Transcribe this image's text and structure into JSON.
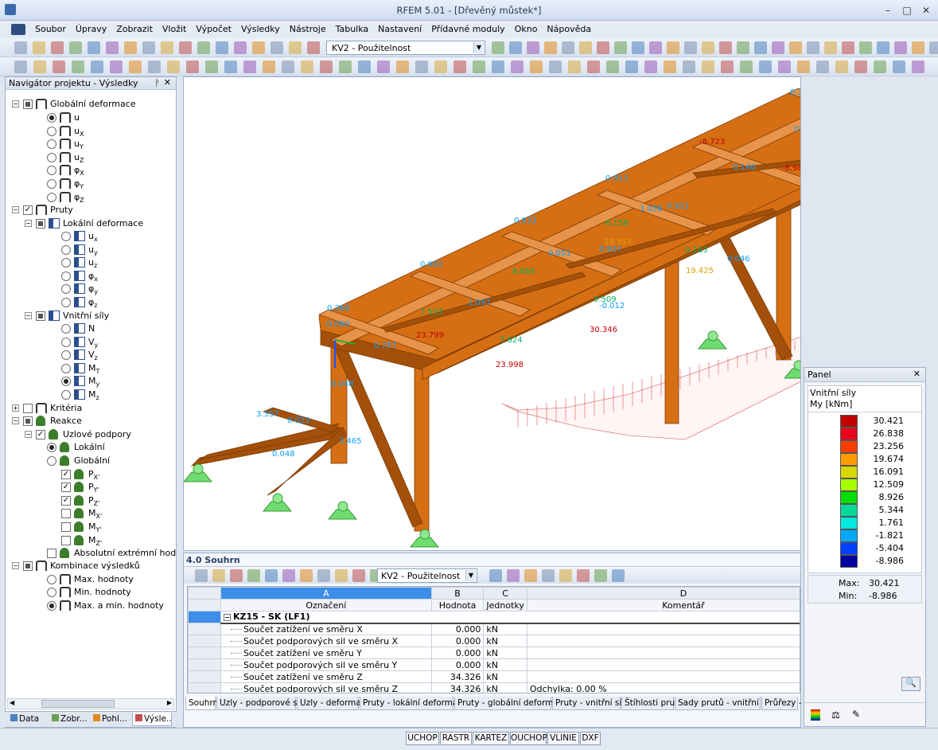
{
  "window": {
    "title": "RFEM 5.01 - [Dřevěný můstek*]"
  },
  "menu": [
    "Soubor",
    "Úpravy",
    "Zobrazit",
    "Vložit",
    "Výpočet",
    "Výsledky",
    "Nástroje",
    "Tabulka",
    "Nastavení",
    "Přídavné moduly",
    "Okno",
    "Nápověda"
  ],
  "toolbar": {
    "loadcase": "KV2 - Použitelnost"
  },
  "navigator": {
    "title": "Navigátor projektu - Výsledky",
    "items": [
      {
        "label": "Globální deformace",
        "sub": ""
      },
      {
        "label": "u",
        "sub": ""
      },
      {
        "label": "u",
        "sub": "X"
      },
      {
        "label": "u",
        "sub": "Y"
      },
      {
        "label": "u",
        "sub": "Z"
      },
      {
        "label": "φ",
        "sub": "X"
      },
      {
        "label": "φ",
        "sub": "Y"
      },
      {
        "label": "φ",
        "sub": "Z"
      },
      {
        "label": "Pruty",
        "sub": ""
      },
      {
        "label": "Lokální deformace",
        "sub": ""
      },
      {
        "label": "u",
        "sub": "x"
      },
      {
        "label": "u",
        "sub": "y"
      },
      {
        "label": "u",
        "sub": "z"
      },
      {
        "label": "φ",
        "sub": "x"
      },
      {
        "label": "φ",
        "sub": "y"
      },
      {
        "label": "φ",
        "sub": "z"
      },
      {
        "label": "Vnitřní síly",
        "sub": ""
      },
      {
        "label": "N",
        "sub": ""
      },
      {
        "label": "V",
        "sub": "y"
      },
      {
        "label": "V",
        "sub": "z"
      },
      {
        "label": "M",
        "sub": "T"
      },
      {
        "label": "M",
        "sub": "y"
      },
      {
        "label": "M",
        "sub": "z"
      },
      {
        "label": "Kritéria",
        "sub": ""
      },
      {
        "label": "Reakce",
        "sub": ""
      },
      {
        "label": "Uzlové podpory",
        "sub": ""
      },
      {
        "label": "Lokální",
        "sub": ""
      },
      {
        "label": "Globální",
        "sub": ""
      },
      {
        "label": "P",
        "sub": "X'"
      },
      {
        "label": "P",
        "sub": "Y'"
      },
      {
        "label": "P",
        "sub": "Z'"
      },
      {
        "label": "M",
        "sub": "X'"
      },
      {
        "label": "M",
        "sub": "Y'"
      },
      {
        "label": "M",
        "sub": "Z'"
      },
      {
        "label": "Absolutní extrémní hodnota",
        "sub": ""
      },
      {
        "label": "Kombinace výsledků",
        "sub": ""
      },
      {
        "label": "Max. hodnoty",
        "sub": ""
      },
      {
        "label": "Min. hodnoty",
        "sub": ""
      },
      {
        "label": "Max. a min. hodnoty",
        "sub": ""
      }
    ],
    "tabs": [
      "Data",
      "Zobr...",
      "Pohl...",
      "Výsle..."
    ]
  },
  "view_labels": [
    "0.300",
    "0.282",
    "0.061",
    "0.708",
    "-0.061",
    "-8.723",
    "0.146",
    "-8.986",
    "0.913",
    "0.921",
    "1.036",
    "6.158",
    "19.353",
    "0.927",
    "0.933",
    "0.051",
    "19.425",
    "0.046",
    "0.163",
    "0.902",
    "8.655",
    "9.509",
    "-0.012",
    "30.346",
    "1.097",
    "0.366",
    "7.533",
    "23.799",
    "-0.060",
    "0.757",
    "7.624",
    "23.998",
    "0.048",
    "3.357",
    "0.023",
    "3.465",
    "0.048"
  ],
  "results": {
    "title": "4.0 Souhrn",
    "loadcase": "KV2 - Použitelnost",
    "col_letters": [
      "A",
      "B",
      "C",
      "D"
    ],
    "col_headers": [
      "Označení",
      "Hodnota",
      "Jednotky",
      "Komentář"
    ],
    "group": "KZ15 - SK  (LF1)",
    "rows": [
      {
        "label": "Součet zatížení ve směru X",
        "value": "0.000",
        "unit": "kN",
        "comment": ""
      },
      {
        "label": "Součet podporových sil ve směru X",
        "value": "0.000",
        "unit": "kN",
        "comment": ""
      },
      {
        "label": "Součet zatížení ve směru Y",
        "value": "0.000",
        "unit": "kN",
        "comment": ""
      },
      {
        "label": "Součet podporových sil ve směru Y",
        "value": "0.000",
        "unit": "kN",
        "comment": ""
      },
      {
        "label": "Součet zatížení ve směru Z",
        "value": "34.326",
        "unit": "kN",
        "comment": ""
      },
      {
        "label": "Součet podporových sil ve směru Z",
        "value": "34.326",
        "unit": "kN",
        "comment": "Odchylka:  0.00 %"
      }
    ],
    "tabs": [
      "Souhrn",
      "Uzly - podporové síly",
      "Uzly - deformace",
      "Pruty - lokální deformace",
      "Pruty - globální deformace",
      "Pruty - vnitřní síly",
      "Štíhlosti prutů",
      "Sady prutů - vnitřní síly",
      "Průřezy -"
    ]
  },
  "panel": {
    "title": "Panel",
    "subtitle": "Vnitřní síly",
    "quantity": "My [kNm]",
    "legend": [
      {
        "value": "30.421",
        "color": "#c00000"
      },
      {
        "value": "26.838",
        "color": "#e8001c"
      },
      {
        "value": "23.256",
        "color": "#ff3d00"
      },
      {
        "value": "19.674",
        "color": "#ff9d00"
      },
      {
        "value": "16.091",
        "color": "#d8d800"
      },
      {
        "value": "12.509",
        "color": "#a8ff00"
      },
      {
        "value": "8.926",
        "color": "#00e000"
      },
      {
        "value": "5.344",
        "color": "#00d89a"
      },
      {
        "value": "1.761",
        "color": "#00e8e0"
      },
      {
        "value": "-1.821",
        "color": "#00a8ff"
      },
      {
        "value": "-5.404",
        "color": "#0040ff"
      },
      {
        "value": "-8.986",
        "color": "#0000a0"
      }
    ],
    "max_label": "Max:",
    "max": "30.421",
    "min_label": "Min:",
    "min": "-8.986"
  },
  "statusbar": [
    "UCHOP",
    "RASTR",
    "KARTEZ",
    "OUCHOP",
    "VLINIE",
    "DXF"
  ]
}
